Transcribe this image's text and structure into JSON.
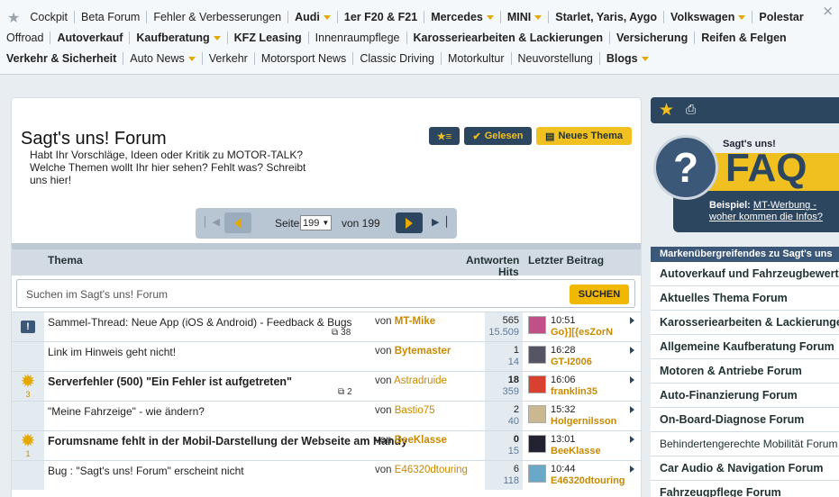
{
  "topnav": {
    "row1": [
      {
        "label": "Cockpit",
        "bold": false,
        "dd": false
      },
      {
        "label": "Beta Forum",
        "bold": false,
        "dd": false
      },
      {
        "label": "Fehler & Verbesserungen",
        "bold": false,
        "dd": false
      },
      {
        "label": "Audi",
        "bold": true,
        "dd": true
      },
      {
        "label": "1er F20 & F21",
        "bold": true,
        "dd": false
      },
      {
        "label": "Mercedes",
        "bold": true,
        "dd": true
      },
      {
        "label": "MINI",
        "bold": true,
        "dd": true
      },
      {
        "label": "Starlet, Yaris, Aygo",
        "bold": true,
        "dd": false
      },
      {
        "label": "Volkswagen",
        "bold": true,
        "dd": true
      },
      {
        "label": "Polestar",
        "bold": true,
        "dd": false
      }
    ],
    "row2": [
      {
        "label": "Offroad",
        "bold": false,
        "dd": false
      },
      {
        "label": "Autoverkauf",
        "bold": true,
        "dd": false
      },
      {
        "label": "Kaufberatung",
        "bold": true,
        "dd": true
      },
      {
        "label": "KFZ Leasing",
        "bold": true,
        "dd": false
      },
      {
        "label": "Innenraumpflege",
        "bold": false,
        "dd": false
      },
      {
        "label": "Karosseriearbeiten & Lackierungen",
        "bold": true,
        "dd": false
      },
      {
        "label": "Versicherung",
        "bold": true,
        "dd": false
      },
      {
        "label": "Reifen & Felgen",
        "bold": true,
        "dd": false
      }
    ],
    "row3": [
      {
        "label": "Verkehr & Sicherheit",
        "bold": true,
        "dd": false
      },
      {
        "label": "Auto News",
        "bold": false,
        "dd": true
      },
      {
        "label": "Verkehr",
        "bold": false,
        "dd": false
      },
      {
        "label": "Motorsport News",
        "bold": false,
        "dd": false
      },
      {
        "label": "Classic Driving",
        "bold": false,
        "dd": false
      },
      {
        "label": "Motorkultur",
        "bold": false,
        "dd": false
      },
      {
        "label": "Neuvorstellung",
        "bold": false,
        "dd": false
      },
      {
        "label": "Blogs",
        "bold": true,
        "dd": true
      }
    ],
    "close": "×"
  },
  "forum": {
    "title": "Sagt's uns! Forum",
    "description": "Habt Ihr Vorschläge, Ideen oder Kritik zu MOTOR-TALK? Welche Themen wollt Ihr hier sehen? Fehlt was? Schreibt uns hier!",
    "buttons": {
      "read": "Gelesen",
      "new_topic": "Neues Thema"
    }
  },
  "pager": {
    "seite": "Seite",
    "page": "199",
    "von": "von 199"
  },
  "table": {
    "col_thema": "Thema",
    "col_antworten": "Antworten",
    "col_hits": "Hits",
    "col_last": "Letzter Beitrag"
  },
  "search": {
    "placeholder": "Suchen im Sagt's uns! Forum",
    "button": "SUCHEN"
  },
  "rows": [
    {
      "icon": "excl",
      "iconnum": "",
      "title": "Sammel-Thread: Neue App (iOS & Android) - Feedback & Bugs",
      "bold": false,
      "pages": "38",
      "von": "von",
      "author": "MT-Mike",
      "author_bold": true,
      "answers": "565",
      "answers_bold": false,
      "hits": "15.509",
      "time": "10:51",
      "user": "Go}][{esZorN",
      "avatar": "#c05088"
    },
    {
      "icon": "",
      "iconnum": "",
      "title": "Link im Hinweis geht nicht!",
      "bold": false,
      "pages": "",
      "von": "von",
      "author": "Bytemaster",
      "author_bold": true,
      "answers": "1",
      "answers_bold": false,
      "hits": "14",
      "time": "16:28",
      "user": "GT-I2006",
      "avatar": "#556"
    },
    {
      "icon": "sun",
      "iconnum": "3",
      "title": "Serverfehler (500) \"Ein Fehler ist aufgetreten\"",
      "bold": true,
      "pages": "2",
      "von": "von",
      "author": "Astradruide",
      "author_bold": false,
      "answers": "18",
      "answers_bold": true,
      "hits": "359",
      "time": "16:06",
      "user": "franklin35",
      "avatar": "#d84030"
    },
    {
      "icon": "",
      "iconnum": "",
      "title": "\"Meine Fahrzeige\" - wie ändern?",
      "bold": false,
      "pages": "",
      "von": "von",
      "author": "Bastio75",
      "author_bold": false,
      "answers": "2",
      "answers_bold": false,
      "hits": "40",
      "time": "15:32",
      "user": "Holgernilsson",
      "avatar": "#c9b890"
    },
    {
      "icon": "sun",
      "iconnum": "1",
      "title": "Forumsname fehlt in der Mobil-Darstellung der Webseite am Handy",
      "bold": true,
      "pages": "",
      "von": "von",
      "author": "BeeKlasse",
      "author_bold": true,
      "answers": "0",
      "answers_bold": true,
      "hits": "15",
      "time": "13:01",
      "user": "BeeKlasse",
      "avatar": "#223"
    },
    {
      "icon": "",
      "iconnum": "",
      "title": "Bug : \"Sagt's uns! Forum\" erscheint nicht",
      "bold": false,
      "pages": "",
      "von": "von",
      "author": "E46320dtouring",
      "author_bold": false,
      "answers": "6",
      "answers_bold": false,
      "hits": "118",
      "time": "10:44",
      "user": "E46320dtouring",
      "avatar": "#6aa8c8"
    }
  ],
  "sidebar": {
    "faq_small": "Sagt's uns!",
    "faq_big": "FAQ",
    "faq_q": "?",
    "faq_label": "Beispiel:",
    "faq_link": "MT-Werbung - woher kommen die Infos?",
    "list_header": "Markenübergreifendes zu Sagt's uns",
    "items": [
      {
        "label": "Autoverkauf und Fahrzeugbewertung",
        "bold": true
      },
      {
        "label": "Aktuelles Thema Forum",
        "bold": true
      },
      {
        "label": "Karosseriearbeiten & Lackierungen",
        "bold": true
      },
      {
        "label": "Allgemeine Kaufberatung Forum",
        "bold": true
      },
      {
        "label": "Motoren & Antriebe Forum",
        "bold": true
      },
      {
        "label": "Auto-Finanzierung Forum",
        "bold": true
      },
      {
        "label": "On-Board-Diagnose Forum",
        "bold": true
      },
      {
        "label": "Behindertengerechte Mobilität Forum",
        "bold": false
      },
      {
        "label": "Car Audio & Navigation Forum",
        "bold": true
      },
      {
        "label": "Fahrzeugpflege Forum",
        "bold": true
      }
    ]
  },
  "colors": {
    "accent": "#f0c020",
    "navy": "#2d4660",
    "link": "#c88a00"
  }
}
